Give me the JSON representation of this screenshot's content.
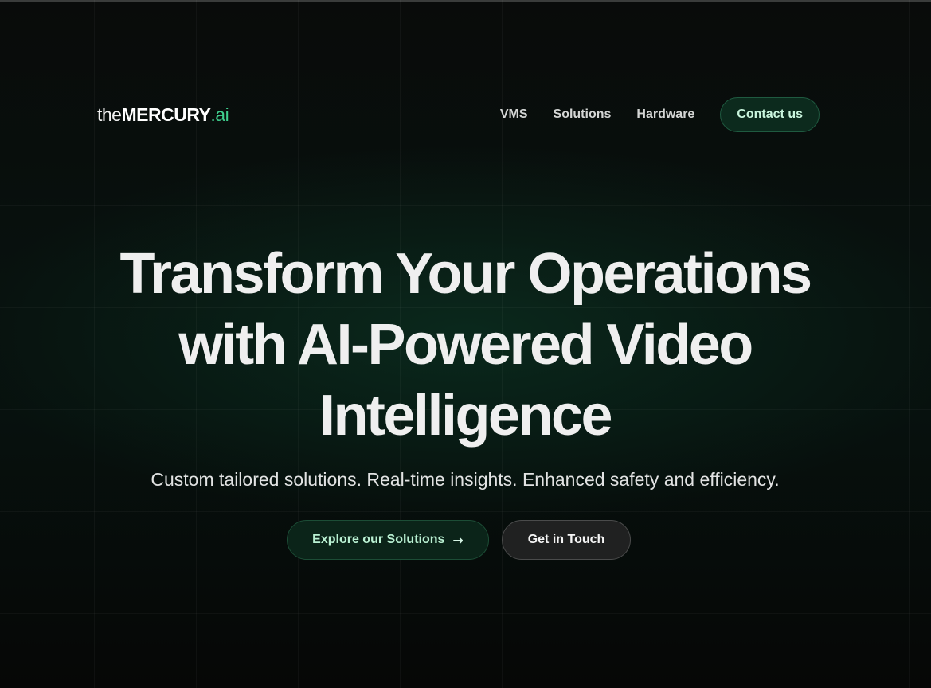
{
  "brand": {
    "prefix": "the",
    "name": "MERCURY",
    "suffix": ".ai",
    "accent_color": "#3fcf8e"
  },
  "nav": {
    "links": [
      {
        "label": "VMS"
      },
      {
        "label": "Solutions"
      },
      {
        "label": "Hardware"
      }
    ],
    "contact_label": "Contact us"
  },
  "hero": {
    "headline_lines": [
      "Transform Your Operations",
      "with AI-Powered Video",
      "Intelligence"
    ],
    "subheadline": "Custom tailored solutions. Real-time insights. Enhanced safety and efficiency.",
    "primary_cta": {
      "label": "Explore our Solutions",
      "icon": "arrow-right-icon"
    },
    "secondary_cta": {
      "label": "Get in Touch"
    }
  },
  "colors": {
    "background": "#070807",
    "primary_button_bg": "#0b2419",
    "primary_button_text": "#b9f0d2",
    "secondary_button_bg": "#202121"
  }
}
